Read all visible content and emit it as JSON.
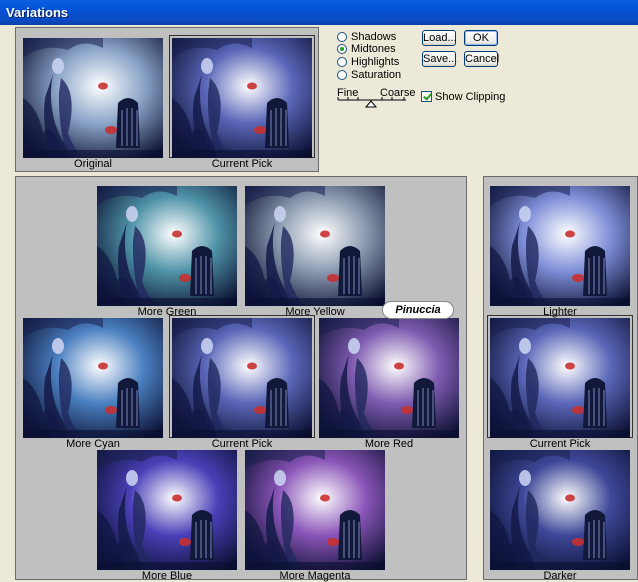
{
  "window": {
    "title": "Variations"
  },
  "tones": {
    "options": [
      {
        "label": "Shadows",
        "selected": false
      },
      {
        "label": "Midtones",
        "selected": true
      },
      {
        "label": "Highlights",
        "selected": false
      },
      {
        "label": "Saturation",
        "selected": false
      }
    ]
  },
  "slider": {
    "left_label": "Fine",
    "right_label": "Coarse"
  },
  "buttons": {
    "load": "Load...",
    "save": "Save...",
    "ok": "OK",
    "cancel": "Cancel"
  },
  "show_clipping": {
    "label": "Show Clipping",
    "checked": true
  },
  "top": {
    "original": "Original",
    "current": "Current Pick"
  },
  "grid": {
    "more_green": "More Green",
    "more_yellow": "More Yellow",
    "more_cyan": "More Cyan",
    "current": "Current Pick",
    "more_red": "More Red",
    "more_blue": "More Blue",
    "more_magenta": "More Magenta"
  },
  "brightness": {
    "lighter": "Lighter",
    "current": "Current Pick",
    "darker": "Darker"
  },
  "watermark": "Pinuccia",
  "colors": {
    "original": "#8aa4c8",
    "current": "#5a66b8",
    "more_green": "#4f93a8",
    "more_yellow": "#8b9ab0",
    "more_cyan": "#4a7fc0",
    "more_red": "#7e5bb0",
    "more_blue": "#4a40b8",
    "more_magenta": "#8a55b8",
    "lighter": "#7e8ed8",
    "darker": "#3e4898"
  }
}
